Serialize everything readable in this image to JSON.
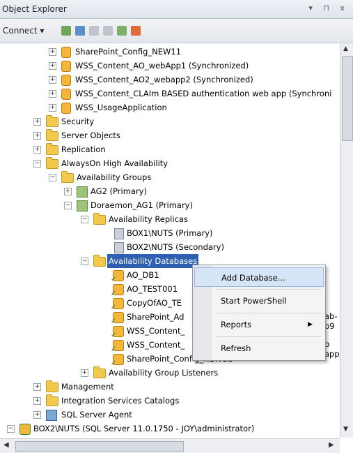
{
  "window": {
    "title": "Object Explorer",
    "controls": "▾ ⊓ x"
  },
  "toolbar": {
    "connect_label": "Connect ▾"
  },
  "tree": {
    "rows": [
      {
        "label": "SharePoint_Config_NEW11",
        "icon": "database-icon"
      },
      {
        "label": "WSS_Content_AO_webApp1 (Synchronized)",
        "icon": "database-icon"
      },
      {
        "label": "WSS_Content_AO2_webapp2 (Synchronized)",
        "icon": "database-icon"
      },
      {
        "label": "WSS_Content_CLAIm BASED authentication web app (Synchroni",
        "icon": "database-icon"
      },
      {
        "label": "WSS_UsageApplication",
        "icon": "database-icon"
      },
      {
        "label": "Security",
        "icon": "folder-icon"
      },
      {
        "label": "Server Objects",
        "icon": "folder-icon"
      },
      {
        "label": "Replication",
        "icon": "folder-icon"
      },
      {
        "label": "AlwaysOn High Availability",
        "icon": "folder-icon"
      },
      {
        "label": "Availability Groups",
        "icon": "folder-icon"
      },
      {
        "label": "AG2 (Primary)",
        "icon": "availability-group-icon"
      },
      {
        "label": "Doraemon_AG1 (Primary)",
        "icon": "availability-group-icon"
      },
      {
        "label": "Availability Replicas",
        "icon": "folder-icon"
      },
      {
        "label": "BOX1\\NUTS (Primary)",
        "icon": "replica-icon"
      },
      {
        "label": "BOX2\\NUTS (Secondary)",
        "icon": "replica-icon"
      },
      {
        "label": "Availability Databases",
        "icon": "folder-icon"
      },
      {
        "label": "AO_DB1",
        "icon": "database-check-icon"
      },
      {
        "label": "AO_TEST001",
        "icon": "database-check-icon"
      },
      {
        "label": "CopyOfAO_TE",
        "icon": "database-check-icon"
      },
      {
        "label": "SharePoint_Ad",
        "icon": "database-check-icon"
      },
      {
        "label": "WSS_Content_",
        "icon": "database-check-icon"
      },
      {
        "label": "WSS_Content_",
        "icon": "database-check-icon"
      },
      {
        "label": "SharePoint_Config_NEW11",
        "icon": "database-check-icon"
      },
      {
        "label": "Availability Group Listeners",
        "icon": "folder-icon"
      },
      {
        "label": "Management",
        "icon": "folder-icon"
      },
      {
        "label": "Integration Services Catalogs",
        "icon": "folder-icon"
      },
      {
        "label": "SQL Server Agent",
        "icon": "sql-agent-icon"
      },
      {
        "label": "BOX2\\NUTS (SQL Server 11.0.1750 - JOY\\administrator)",
        "icon": "server-icon"
      }
    ],
    "overflow_suffixes": [
      "ab-b9",
      "b app"
    ]
  },
  "context_menu": {
    "items": [
      {
        "label": "Add Database..."
      },
      {
        "label": "Start PowerShell"
      },
      {
        "label": "Reports",
        "has_submenu": true
      },
      {
        "label": "Refresh"
      }
    ]
  },
  "colors": {
    "selection": "#2f5fb0",
    "menu_highlight": "#d6e4f7"
  }
}
